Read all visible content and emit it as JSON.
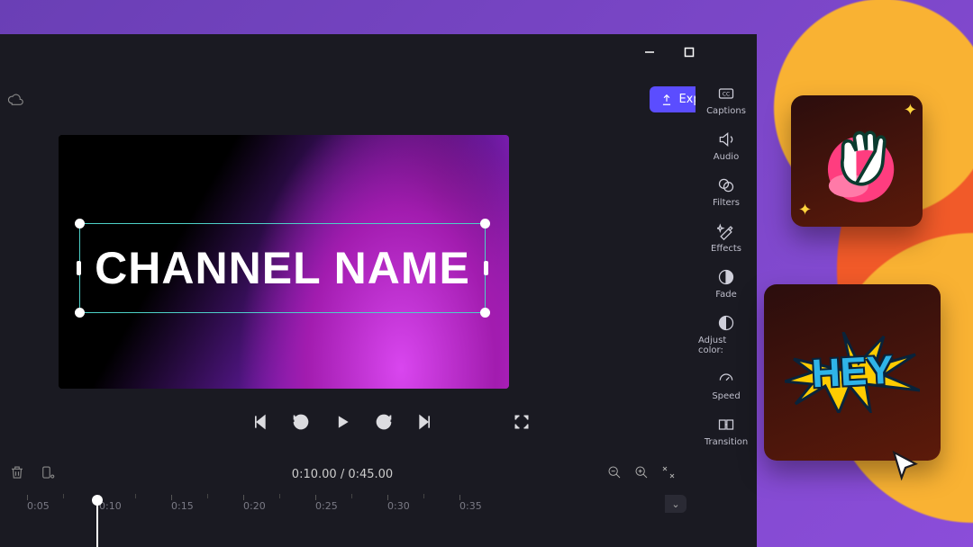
{
  "header": {
    "export_label": "Export",
    "aspect_ratio": "16:9"
  },
  "preview": {
    "selected_text": "CHANNEL NAME"
  },
  "playback": {
    "current_time": "0:10.00",
    "total_time": "0:45.00"
  },
  "timeline": {
    "ticks": [
      "0:05",
      "0:10",
      "0:15",
      "0:20",
      "0:25",
      "0:30",
      "0:35"
    ],
    "playhead_at": "0:10"
  },
  "side_panel": {
    "items": [
      {
        "id": "captions",
        "label": "Captions"
      },
      {
        "id": "audio",
        "label": "Audio"
      },
      {
        "id": "filters",
        "label": "Filters"
      },
      {
        "id": "effects",
        "label": "Effects"
      },
      {
        "id": "fade",
        "label": "Fade"
      },
      {
        "id": "adjust-colors",
        "label": "Adjust color:"
      },
      {
        "id": "speed",
        "label": "Speed"
      },
      {
        "id": "transition",
        "label": "Transition"
      }
    ]
  },
  "stickers": {
    "sticker1_name": "waving-hand-sticker",
    "sticker2_text": "HEY"
  }
}
